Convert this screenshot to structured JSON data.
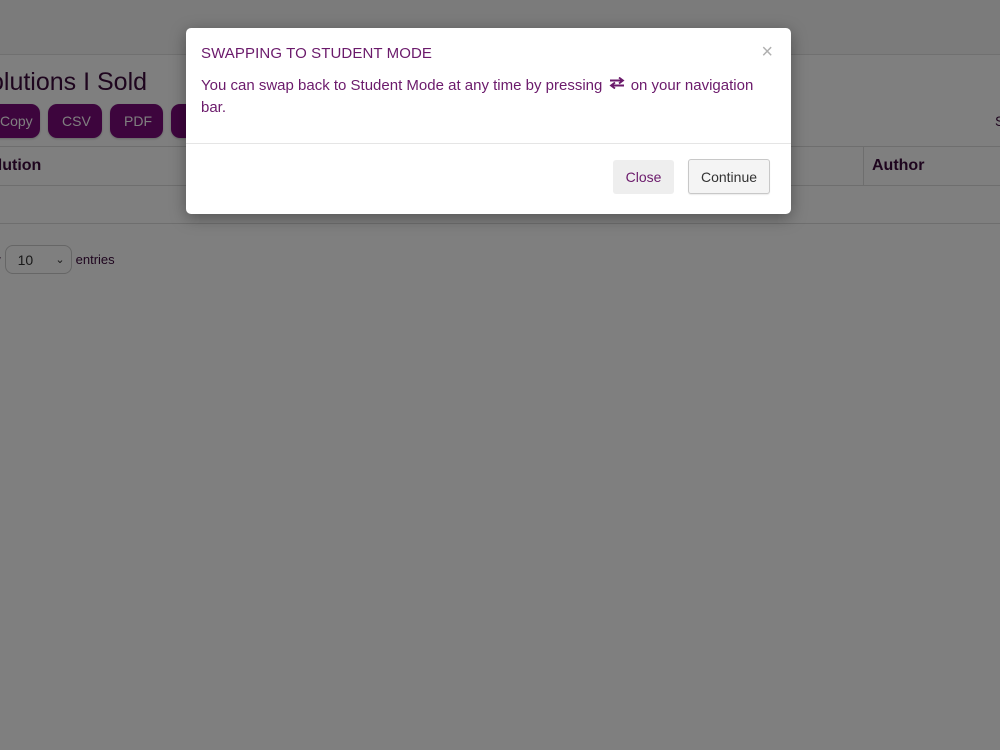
{
  "page": {
    "title": "olutions I Sold",
    "export_buttons": {
      "copy": "Copy",
      "csv": "CSV",
      "pdf": "PDF"
    },
    "search_edge_text": "S",
    "table": {
      "columns": [
        "olution",
        "Author"
      ]
    },
    "length_menu": {
      "prefix": "ow",
      "selected": "10",
      "suffix": "entries"
    }
  },
  "modal": {
    "title": "SWAPPING TO STUDENT MODE",
    "close_symbol": "×",
    "body_before_icon": "You can swap back to Student Mode at any time by pressing",
    "body_after_icon": "on your navigation bar.",
    "icon": "swap-arrows-icon",
    "close_label": "Close",
    "continue_label": "Continue"
  },
  "colors": {
    "brand_purple": "#7b0a7b",
    "text_purple": "#6b1a6b",
    "backdrop": "rgba(0,0,0,0.5)"
  }
}
